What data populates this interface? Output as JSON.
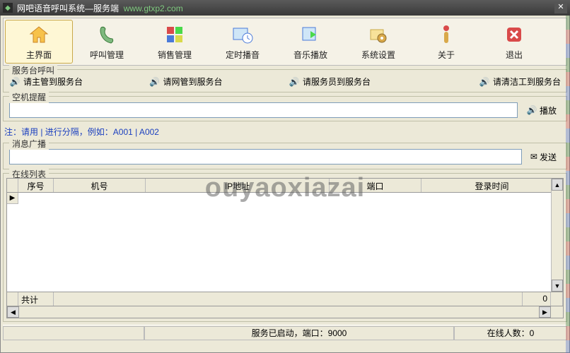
{
  "title": {
    "app": "网吧语音呼叫系统—服务端",
    "url": "www.gtxp2.com"
  },
  "toolbar": [
    {
      "label": "主界面",
      "active": true
    },
    {
      "label": "呼叫管理"
    },
    {
      "label": "销售管理"
    },
    {
      "label": "定时播音"
    },
    {
      "label": "音乐播放"
    },
    {
      "label": "系统设置"
    },
    {
      "label": "关于"
    },
    {
      "label": "退出"
    }
  ],
  "groups": {
    "service_call": {
      "legend": "服务台呼叫",
      "buttons": [
        "请主管到服务台",
        "请网管到服务台",
        "请服务员到服务台",
        "请清洁工到服务台"
      ]
    },
    "idle_remind": {
      "legend": "空机提醒",
      "play": "播放",
      "note": "注：请用 | 进行分隔，例如：A001 | A002"
    },
    "broadcast": {
      "legend": "消息广播",
      "send": "发送"
    },
    "online_list": {
      "legend": "在线列表",
      "columns": [
        "序号",
        "机号",
        "IP地址",
        "端口",
        "登录时间"
      ],
      "footer_label": "共计",
      "footer_count": "0"
    }
  },
  "status": {
    "service": "服务已启动，端口：9000",
    "online": "在线人数：0"
  },
  "watermark": "ouyaoxiazai"
}
